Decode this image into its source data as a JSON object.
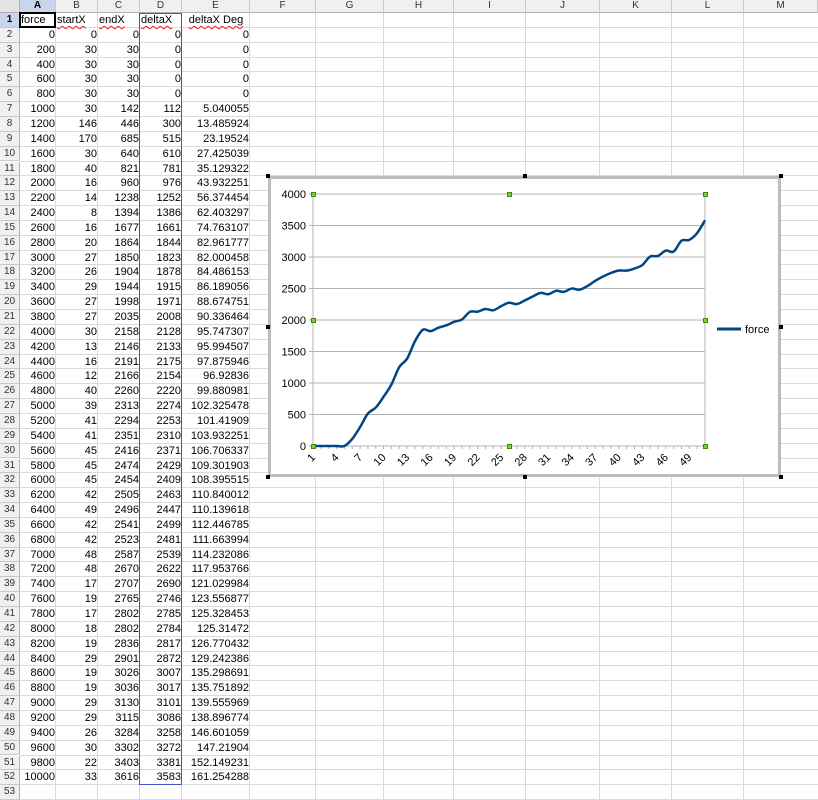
{
  "spreadsheet": {
    "columns": [
      "A",
      "B",
      "C",
      "D",
      "E",
      "F",
      "G",
      "H",
      "I",
      "J",
      "K",
      "L",
      "M"
    ],
    "selected_column": "A",
    "selected_row": "1",
    "headers": [
      "force",
      "startX",
      "endX",
      "deltaX",
      "deltaX Deg"
    ],
    "rows": [
      [
        "0",
        "0",
        "0",
        "0",
        "0"
      ],
      [
        "200",
        "30",
        "30",
        "0",
        "0"
      ],
      [
        "400",
        "30",
        "30",
        "0",
        "0"
      ],
      [
        "600",
        "30",
        "30",
        "0",
        "0"
      ],
      [
        "800",
        "30",
        "30",
        "0",
        "0"
      ],
      [
        "1000",
        "30",
        "142",
        "112",
        "5.040055"
      ],
      [
        "1200",
        "146",
        "446",
        "300",
        "13.485924"
      ],
      [
        "1400",
        "170",
        "685",
        "515",
        "23.19524"
      ],
      [
        "1600",
        "30",
        "640",
        "610",
        "27.425039"
      ],
      [
        "1800",
        "40",
        "821",
        "781",
        "35.129322"
      ],
      [
        "2000",
        "16",
        "960",
        "976",
        "43.932251"
      ],
      [
        "2200",
        "14",
        "1238",
        "1252",
        "56.374454"
      ],
      [
        "2400",
        "8",
        "1394",
        "1386",
        "62.403297"
      ],
      [
        "2600",
        "16",
        "1677",
        "1661",
        "74.763107"
      ],
      [
        "2800",
        "20",
        "1864",
        "1844",
        "82.961777"
      ],
      [
        "3000",
        "27",
        "1850",
        "1823",
        "82.000458"
      ],
      [
        "3200",
        "26",
        "1904",
        "1878",
        "84.486153"
      ],
      [
        "3400",
        "29",
        "1944",
        "1915",
        "86.189056"
      ],
      [
        "3600",
        "27",
        "1998",
        "1971",
        "88.674751"
      ],
      [
        "3800",
        "27",
        "2035",
        "2008",
        "90.336464"
      ],
      [
        "4000",
        "30",
        "2158",
        "2128",
        "95.747307"
      ],
      [
        "4200",
        "13",
        "2146",
        "2133",
        "95.994507"
      ],
      [
        "4400",
        "16",
        "2191",
        "2175",
        "97.875946"
      ],
      [
        "4600",
        "12",
        "2166",
        "2154",
        "96.92836"
      ],
      [
        "4800",
        "40",
        "2260",
        "2220",
        "99.880981"
      ],
      [
        "5000",
        "39",
        "2313",
        "2274",
        "102.325478"
      ],
      [
        "5200",
        "41",
        "2294",
        "2253",
        "101.41909"
      ],
      [
        "5400",
        "41",
        "2351",
        "2310",
        "103.932251"
      ],
      [
        "5600",
        "45",
        "2416",
        "2371",
        "106.706337"
      ],
      [
        "5800",
        "45",
        "2474",
        "2429",
        "109.301903"
      ],
      [
        "6000",
        "45",
        "2454",
        "2409",
        "108.395515"
      ],
      [
        "6200",
        "42",
        "2505",
        "2463",
        "110.840012"
      ],
      [
        "6400",
        "49",
        "2496",
        "2447",
        "110.139618"
      ],
      [
        "6600",
        "42",
        "2541",
        "2499",
        "112.446785"
      ],
      [
        "6800",
        "42",
        "2523",
        "2481",
        "111.663994"
      ],
      [
        "7000",
        "48",
        "2587",
        "2539",
        "114.232086"
      ],
      [
        "7200",
        "48",
        "2670",
        "2622",
        "117.953766"
      ],
      [
        "7400",
        "17",
        "2707",
        "2690",
        "121.029984"
      ],
      [
        "7600",
        "19",
        "2765",
        "2746",
        "123.556877"
      ],
      [
        "7800",
        "17",
        "2802",
        "2785",
        "125.328453"
      ],
      [
        "8000",
        "18",
        "2802",
        "2784",
        "125.31472"
      ],
      [
        "8200",
        "19",
        "2836",
        "2817",
        "126.770432"
      ],
      [
        "8400",
        "29",
        "2901",
        "2872",
        "129.242386"
      ],
      [
        "8600",
        "19",
        "3026",
        "3007",
        "135.298691"
      ],
      [
        "8800",
        "19",
        "3036",
        "3017",
        "135.751892"
      ],
      [
        "9000",
        "29",
        "3130",
        "3101",
        "139.555969"
      ],
      [
        "9200",
        "29",
        "3115",
        "3086",
        "138.896774"
      ],
      [
        "9400",
        "26",
        "3284",
        "3258",
        "146.601059"
      ],
      [
        "9600",
        "30",
        "3302",
        "3272",
        "147.21904"
      ],
      [
        "9800",
        "22",
        "3403",
        "3381",
        "152.149231"
      ],
      [
        "10000",
        "33",
        "3616",
        "3583",
        "161.254288"
      ]
    ]
  },
  "chart_data": {
    "type": "line",
    "legend": "right",
    "grid": "horizontal",
    "x": [
      1,
      2,
      3,
      4,
      5,
      6,
      7,
      8,
      9,
      10,
      11,
      12,
      13,
      14,
      15,
      16,
      17,
      18,
      19,
      20,
      21,
      22,
      23,
      24,
      25,
      26,
      27,
      28,
      29,
      30,
      31,
      32,
      33,
      34,
      35,
      36,
      37,
      38,
      39,
      40,
      41,
      42,
      43,
      44,
      45,
      46,
      47,
      48,
      49,
      50,
      51
    ],
    "x_tick_labels": [
      "1",
      "4",
      "7",
      "10",
      "13",
      "16",
      "19",
      "22",
      "25",
      "28",
      "31",
      "34",
      "37",
      "40",
      "43",
      "46",
      "49"
    ],
    "ylim": [
      0,
      4000
    ],
    "y_ticks": [
      0,
      500,
      1000,
      1500,
      2000,
      2500,
      3000,
      3500,
      4000
    ],
    "series": [
      {
        "name": "force",
        "color": "#004586",
        "values": [
          0,
          0,
          0,
          0,
          0,
          112,
          300,
          515,
          610,
          781,
          976,
          1252,
          1386,
          1661,
          1844,
          1823,
          1878,
          1915,
          1971,
          2008,
          2128,
          2133,
          2175,
          2154,
          2220,
          2274,
          2253,
          2310,
          2371,
          2429,
          2409,
          2463,
          2447,
          2499,
          2481,
          2539,
          2622,
          2690,
          2746,
          2785,
          2784,
          2817,
          2872,
          3007,
          3017,
          3101,
          3086,
          3258,
          3272,
          3381,
          3583
        ]
      }
    ]
  }
}
